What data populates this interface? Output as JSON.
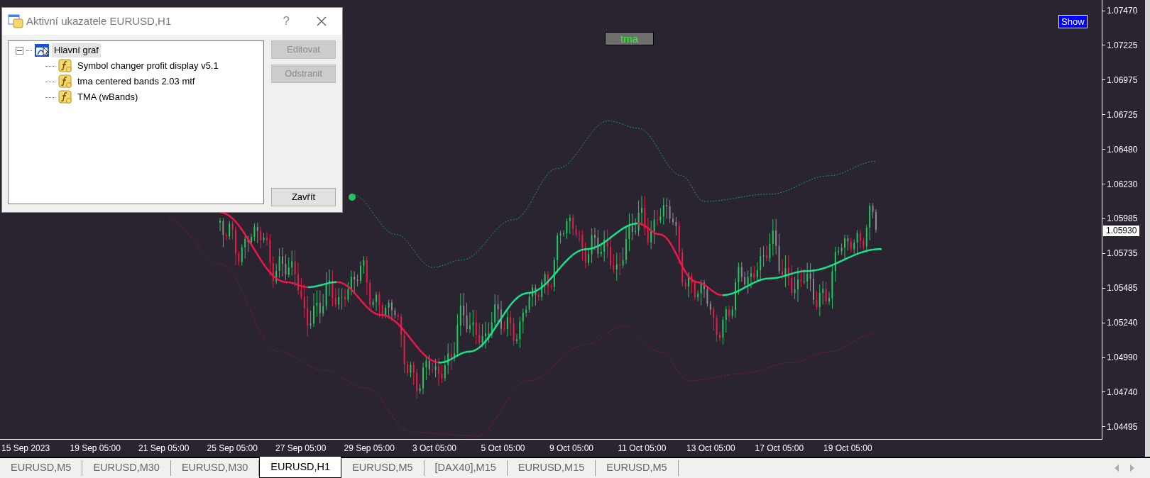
{
  "dialog": {
    "title": "Aktivní ukazatele EURUSD,H1",
    "help": "?",
    "tree": {
      "label": "Hlavní graf",
      "expanded": true,
      "selected": true,
      "children": [
        {
          "label": "Symbol changer profit display v5.1",
          "selected": false
        },
        {
          "label": "tma centered bands 2.03 mtf",
          "selected": false
        },
        {
          "label": "TMA (wBands)",
          "selected": false
        }
      ]
    },
    "buttons": [
      {
        "label": "Editovat",
        "disabled": true
      },
      {
        "label": "Odstranit",
        "disabled": true
      },
      {
        "label": "Zavřít",
        "disabled": false
      }
    ]
  },
  "chart": {
    "show_button": "Show",
    "indicator_label": "tma",
    "price_axis": [
      "1.07470",
      "1.07225",
      "1.06975",
      "1.06725",
      "1.06480",
      "1.06230",
      "1.05985",
      "1.05735",
      "1.05485",
      "1.05240",
      "1.04990",
      "1.04740",
      "1.04495"
    ],
    "current_price": "1.05930",
    "time_axis": [
      "15 Sep 2023",
      "19 Sep 05:00",
      "21 Sep 05:00",
      "25 Sep 05:00",
      "27 Sep 05:00",
      "29 Sep 05:00",
      "3 Oct 05:00",
      "5 Oct 05:00",
      "9 Oct 05:00",
      "11 Oct 05:00",
      "13 Oct 05:00",
      "17 Oct 05:00",
      "19 Oct 05:00"
    ]
  },
  "tabs": [
    {
      "label": "EURUSD,M5",
      "selected": false
    },
    {
      "label": "EURUSD,M30",
      "selected": false
    },
    {
      "label": "EURUSD,M30",
      "selected": false
    },
    {
      "label": "EURUSD,H1",
      "selected": true
    },
    {
      "label": "EURUSD,M5",
      "selected": false
    },
    {
      "label": "[DAX40],M15",
      "selected": false
    },
    {
      "label": "EURUSD,M15",
      "selected": false
    },
    {
      "label": "EURUSD,M5",
      "selected": false
    }
  ]
}
